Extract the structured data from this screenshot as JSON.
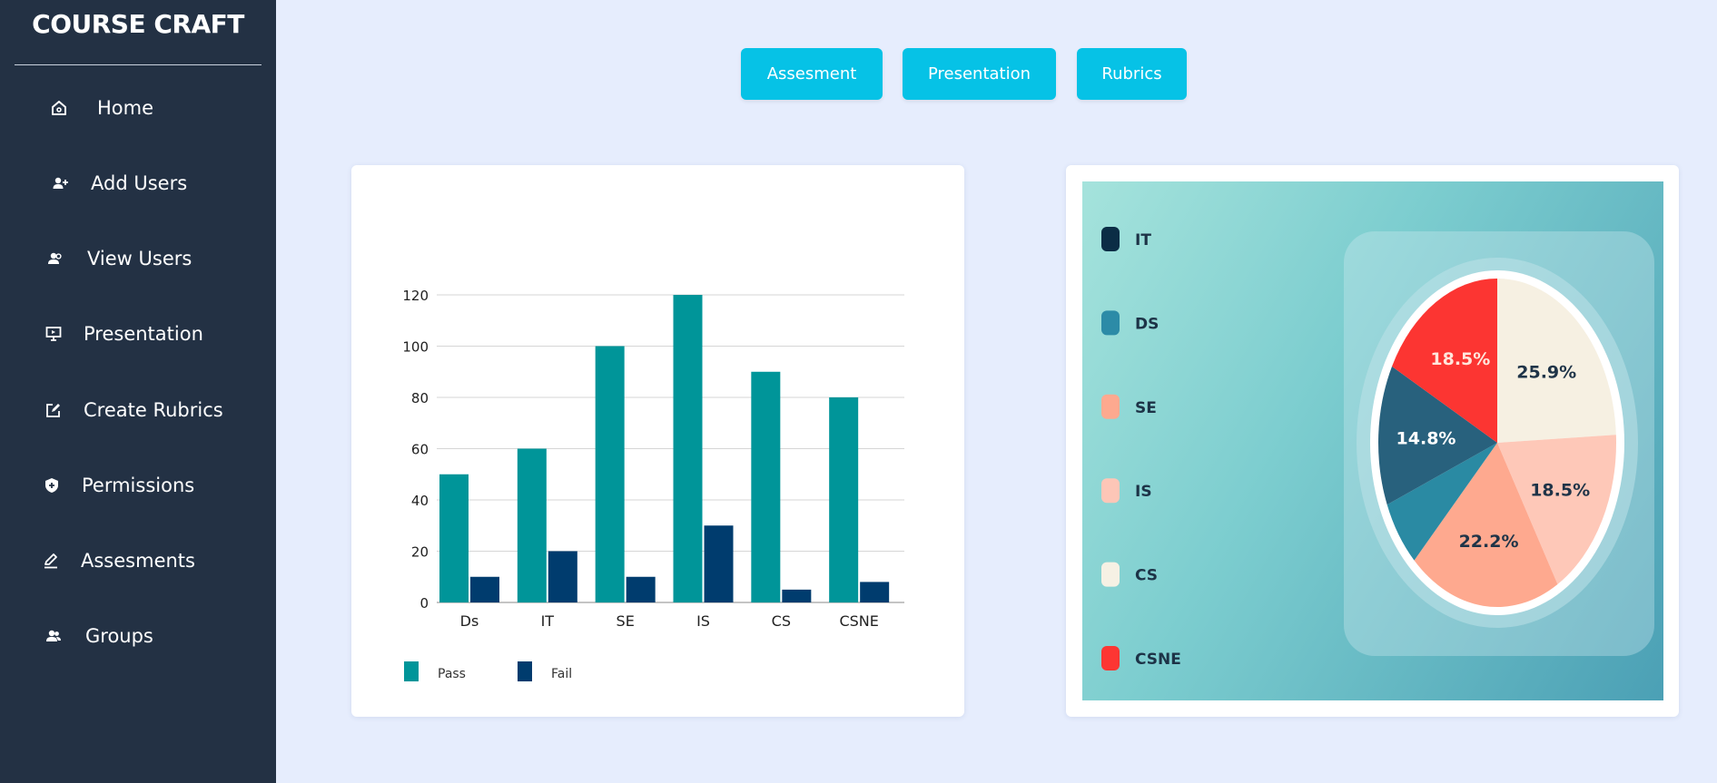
{
  "sidebar": {
    "brand": "COURSE CRAFT",
    "items": [
      {
        "label": "Home",
        "icon": "home-icon"
      },
      {
        "label": "Add Users",
        "icon": "user-plus-icon"
      },
      {
        "label": "View Users",
        "icon": "users-icon"
      },
      {
        "label": "Presentation",
        "icon": "presentation-icon"
      },
      {
        "label": "Create Rubrics",
        "icon": "edit-icon"
      },
      {
        "label": "Permissions",
        "icon": "shield-plus-icon"
      },
      {
        "label": "Assesments",
        "icon": "pen-icon"
      },
      {
        "label": "Groups",
        "icon": "group-icon"
      }
    ]
  },
  "top_buttons": {
    "assesment": "Assesment",
    "presentation": "Presentation",
    "rubrics": "Rubrics"
  },
  "colors": {
    "sidebar_bg": "#233144",
    "page_bg": "#e6edfd",
    "button_bg": "#06c2e6",
    "pass": "#009599",
    "fail": "#003c6e"
  },
  "chart_data": [
    {
      "type": "bar",
      "categories": [
        "Ds",
        "IT",
        "SE",
        "IS",
        "CS",
        "CSNE"
      ],
      "series": [
        {
          "name": "Pass",
          "values": [
            50,
            60,
            100,
            120,
            90,
            80
          ]
        },
        {
          "name": "Fail",
          "values": [
            10,
            20,
            10,
            30,
            5,
            8
          ]
        }
      ],
      "yticks": [
        "0",
        "20",
        "40",
        "60",
        "80",
        "100",
        "120"
      ],
      "ylim": [
        0,
        120
      ],
      "grid": true,
      "legend": "bottom-left"
    },
    {
      "type": "pie",
      "categories": [
        "IT",
        "DS",
        "SE",
        "IS",
        "CS",
        "CSNE"
      ],
      "values": [
        14.8,
        22.2,
        18.5,
        0,
        25.9,
        18.5
      ],
      "slices": [
        {
          "label": "25.9%",
          "value": 25.9,
          "color": "#f6f0e2",
          "text_color": "#1f3448"
        },
        {
          "label": "18.5%",
          "value": 18.5,
          "color": "#fec8b8",
          "text_color": "#1f3448"
        },
        {
          "label": "22.2%",
          "value": 22.2,
          "color": "#fea98f",
          "text_color": "#1f3448"
        },
        {
          "label": "",
          "value": 7.0,
          "color": "#2a8aa3",
          "text_color": "#1f3448"
        },
        {
          "label": "14.8%",
          "value": 14.8,
          "color": "#28617d",
          "text_color": "#ffffff"
        },
        {
          "label": "18.5%",
          "value": 18.5,
          "color": "#fc3532",
          "text_color": "#ffe6dc"
        }
      ],
      "legend_items": [
        {
          "label": "IT",
          "color": "#0b2d45"
        },
        {
          "label": "DS",
          "color": "#2c8ba7"
        },
        {
          "label": "SE",
          "color": "#fda98f"
        },
        {
          "label": "IS",
          "color": "#fdc6b7"
        },
        {
          "label": "CS",
          "color": "#f6f1e4"
        },
        {
          "label": "CSNE",
          "color": "#fd3633"
        }
      ],
      "legend": "left"
    }
  ]
}
